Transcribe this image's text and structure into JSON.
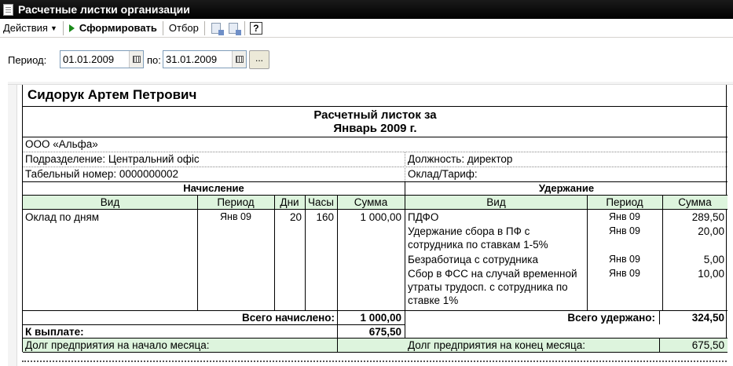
{
  "window": {
    "title": "Расчетные листки организации"
  },
  "toolbar": {
    "actions_label": "Действия",
    "generate_label": "Сформировать",
    "filter_label": "Отбор",
    "help_label": "?"
  },
  "period": {
    "label": "Период:",
    "from": "01.01.2009",
    "to_label": "по:",
    "to": "31.01.2009",
    "more_label": "..."
  },
  "payslip": {
    "employee": "Сидорук Артем Петрович",
    "title_line1": "Расчетный листок за",
    "title_line2": "Январь 2009 г.",
    "organization": "ООО «Альфа»",
    "department": "Подразделение: Центральний офіс",
    "position": "Должность: директор",
    "tab_number": "Табельный номер: 0000000002",
    "salary_rate": "Оклад/Тариф:",
    "accruals_header": "Начисление",
    "deductions_header": "Удержание",
    "acc_cols": {
      "kind": "Вид",
      "period": "Период",
      "days": "Дни",
      "hours": "Часы",
      "sum": "Сумма"
    },
    "ded_cols": {
      "kind": "Вид",
      "period": "Период",
      "sum": "Сумма"
    },
    "accruals": [
      {
        "kind": "Оклад по дням",
        "period": "Янв 09",
        "days": "20",
        "hours": "160",
        "sum": "1 000,00"
      }
    ],
    "deductions": [
      {
        "kind": "ПДФО",
        "period": "Янв 09",
        "sum": "289,50"
      },
      {
        "kind": "Удержание сбора в ПФ с сотрудника по ставкам 1-5%",
        "period": "Янв 09",
        "sum": "20,00"
      },
      {
        "kind": "Безработица с сотрудника",
        "period": "Янв 09",
        "sum": "5,00"
      },
      {
        "kind": "Сбор в ФСС на случай временной утраты трудосп. с сотрудника по ставке 1%",
        "period": "Янв 09",
        "sum": "10,00"
      }
    ],
    "total_accrued_label": "Всего начислено:",
    "total_accrued": "1 000,00",
    "total_deducted_label": "Всего удержано:",
    "total_deducted": "324,50",
    "to_pay_label": "К выплате:",
    "to_pay": "675,50",
    "debt_start_label": "Долг предприятия на начало месяца:",
    "debt_start": "",
    "debt_end_label": "Долг предприятия на конец месяца:",
    "debt_end": "675,50"
  },
  "colors": {
    "title_bar": "#000000",
    "highlight_green": "#ddf4dd",
    "play_icon": "#1a8a1a"
  }
}
